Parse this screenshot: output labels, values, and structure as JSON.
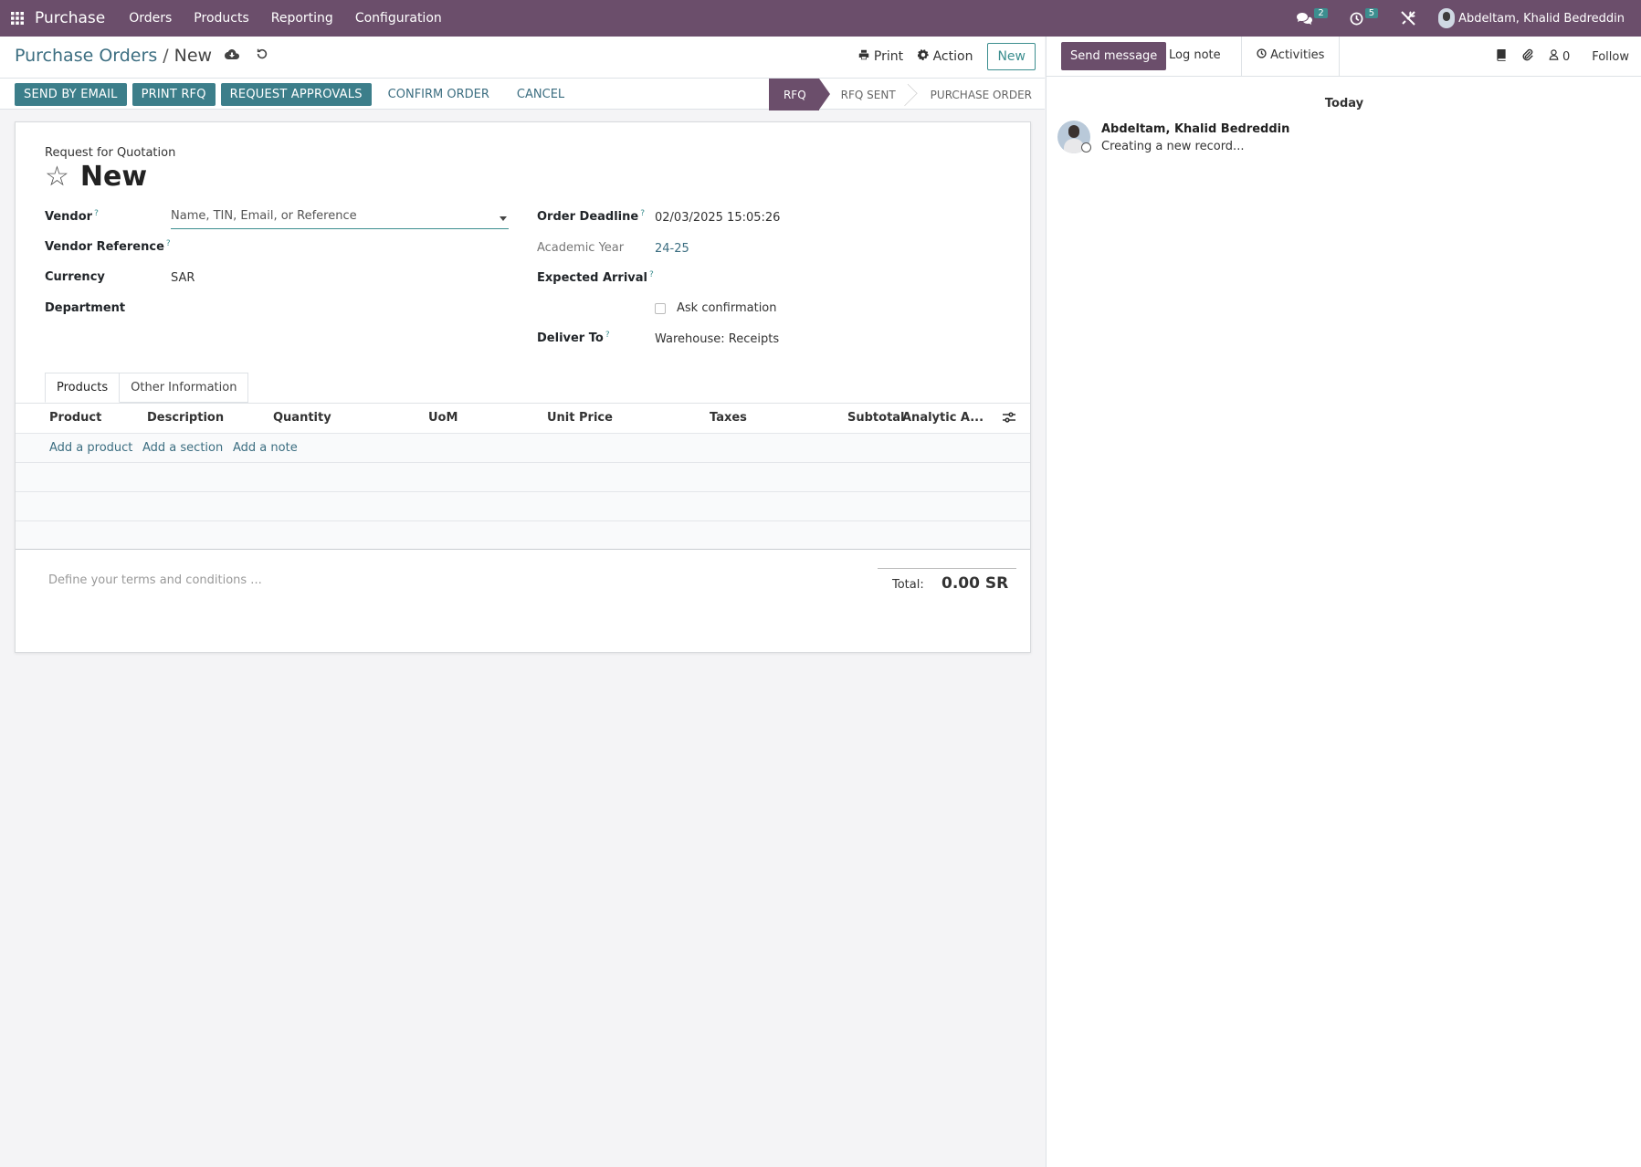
{
  "topbar": {
    "app_name": "Purchase",
    "menu": [
      "Orders",
      "Products",
      "Reporting",
      "Configuration"
    ],
    "messages_count": "2",
    "activities_count": "5",
    "user_name": "Abdeltam, Khalid Bedreddin"
  },
  "breadcrumb": {
    "parent": "Purchase Orders",
    "separator": "/",
    "current": "New"
  },
  "control_panel": {
    "print": "Print",
    "action": "Action",
    "new": "New"
  },
  "status_buttons": {
    "send_by_email": "SEND BY EMAIL",
    "print_rfq": "PRINT RFQ",
    "request_approvals": "REQUEST APPROVALS",
    "confirm_order": "CONFIRM ORDER",
    "cancel": "CANCEL"
  },
  "stages": [
    "RFQ",
    "RFQ SENT",
    "PURCHASE ORDER"
  ],
  "form": {
    "subtitle": "Request for Quotation",
    "title": "New",
    "vendor_label": "Vendor",
    "vendor_placeholder": "Name, TIN, Email, or Reference",
    "vendor_reference_label": "Vendor Reference",
    "currency_label": "Currency",
    "currency_value": "SAR",
    "department_label": "Department",
    "order_deadline_label": "Order Deadline",
    "order_deadline_value": "02/03/2025 15:05:26",
    "academic_year_label": "Academic Year",
    "academic_year_value": "24-25",
    "expected_arrival_label": "Expected Arrival",
    "ask_confirmation_label": "Ask confirmation",
    "deliver_to_label": "Deliver To",
    "deliver_to_value": "Warehouse: Receipts",
    "help_mark": "?"
  },
  "tabs": [
    "Products",
    "Other Information"
  ],
  "table": {
    "columns": [
      "Product",
      "Description",
      "Quantity",
      "UoM",
      "Unit Price",
      "Taxes",
      "Subtotal",
      "Analytic A..."
    ],
    "add_links": [
      "Add a product",
      "Add a section",
      "Add a note"
    ]
  },
  "footer": {
    "terms_placeholder": "Define your terms and conditions ...",
    "total_label": "Total:",
    "total_value": "0.00 SR"
  },
  "chatter": {
    "send_message": "Send message",
    "log_note": "Log note",
    "activities": "Activities",
    "followers_count": "0",
    "follow": "Follow",
    "date_separator": "Today",
    "message_author": "Abdeltam, Khalid Bedreddin",
    "message_body": "Creating a new record..."
  },
  "colors": {
    "brand": "#6b4e6b",
    "primary": "#3c7e8a",
    "link": "#3c6e81"
  }
}
